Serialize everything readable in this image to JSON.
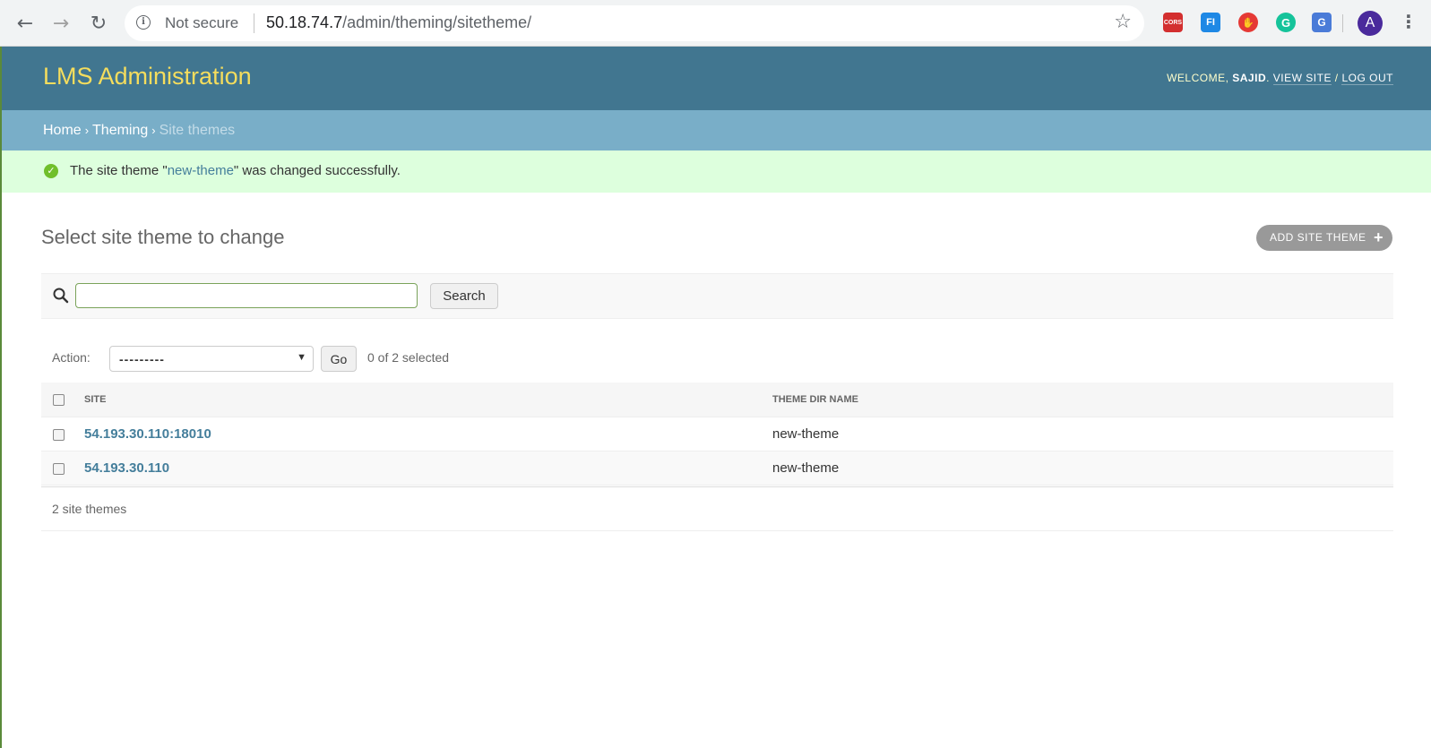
{
  "browser": {
    "security_label": "Not secure",
    "url_host": "50.18.74.7",
    "url_path": "/admin/theming/sitetheme/",
    "extensions": [
      {
        "name": "cors-extension-icon",
        "label": "CORS",
        "color": "#d32f2f"
      },
      {
        "name": "fi-extension-icon",
        "label": "FI",
        "color": "#1e88e5"
      },
      {
        "name": "adblock-extension-icon",
        "label": "✋",
        "color": "#e53935"
      },
      {
        "name": "grammarly-extension-icon",
        "label": "G",
        "color": "#15c39a"
      },
      {
        "name": "translate-extension-icon",
        "label": "G",
        "color": "#4a7bd8"
      }
    ],
    "avatar_letter": "A"
  },
  "header": {
    "branding": "LMS Administration",
    "welcome": "Welcome,",
    "username": "sajid",
    "view_site": "View site",
    "log_out": "Log out"
  },
  "breadcrumbs": {
    "home": "Home",
    "app": "Theming",
    "current": "Site themes"
  },
  "message": {
    "prefix": "The site theme \"",
    "link": "new-theme",
    "suffix": "\" was changed successfully."
  },
  "main": {
    "title": "Select site theme to change",
    "add_button": "ADD SITE THEME",
    "search_button": "Search",
    "search_value": "",
    "action_label": "Action:",
    "action_selected": "---------",
    "go_button": "Go",
    "selection_counter": "0 of 2 selected"
  },
  "table": {
    "columns": [
      "SITE",
      "THEME DIR NAME"
    ],
    "rows": [
      {
        "site": "54.193.30.110:18010",
        "theme_dir_name": "new-theme"
      },
      {
        "site": "54.193.30.110",
        "theme_dir_name": "new-theme"
      }
    ]
  },
  "paginator": "2 site themes",
  "colors": {
    "header_bg": "#417690",
    "branding": "#f5dd5d",
    "breadcrumbs_bg": "#79aec8",
    "success_bg": "#ddffdd",
    "link": "#447e9b"
  }
}
